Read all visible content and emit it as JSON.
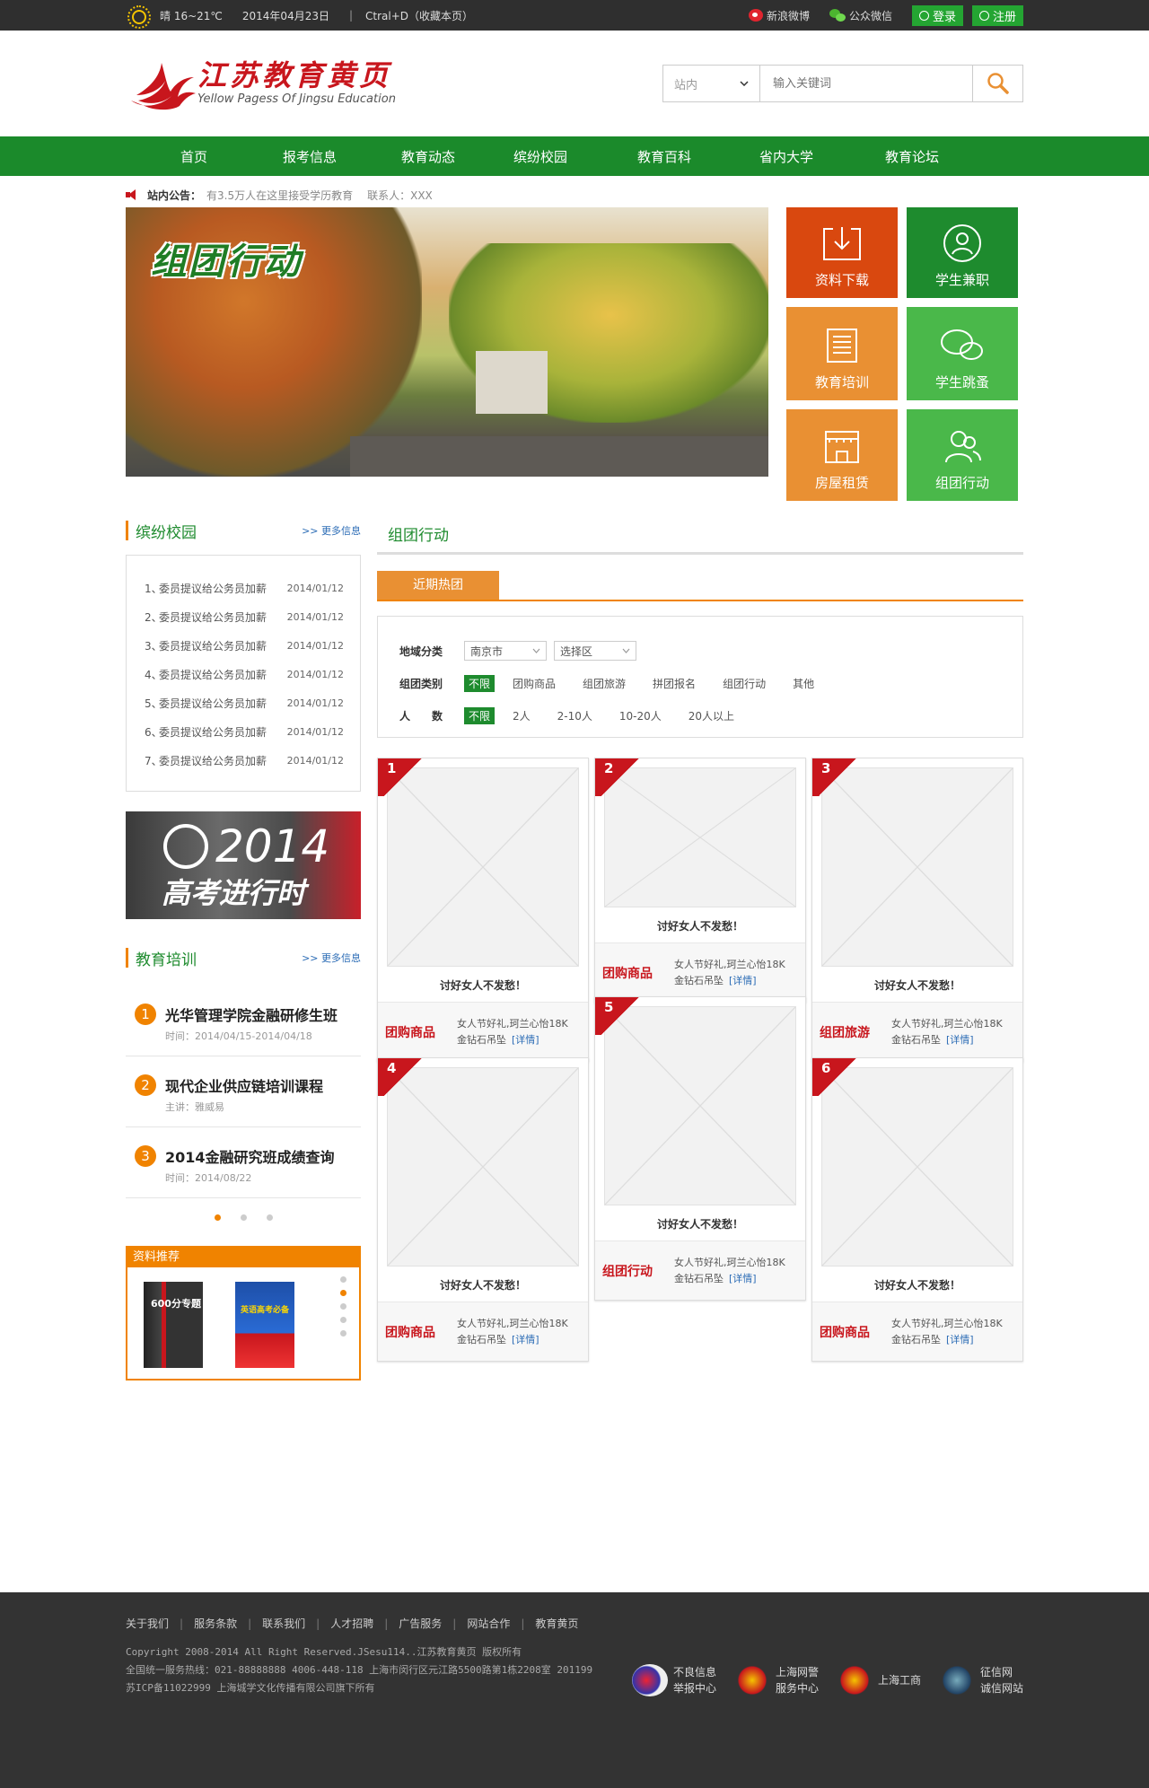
{
  "topbar": {
    "weather": "晴 16~21℃",
    "date": "2014年04月23日",
    "sep": "|",
    "bookmark": "Ctral+D（收藏本页）",
    "weibo": "新浪微博",
    "wechat": "公众微信",
    "login": "登录",
    "register": "注册"
  },
  "header": {
    "logo_title": "江苏教育黄页",
    "logo_sub": "Yellow Pagess Of Jingsu Education",
    "search_scope": "站内",
    "search_placeholder": "输入关键词"
  },
  "nav": [
    "首页",
    "报考信息",
    "教育动态",
    "缤纷校园",
    "教育百科",
    "省内大学",
    "教育论坛"
  ],
  "notice": {
    "label": "站内公告：",
    "text": "有3.5万人在这里接受学历教育",
    "contact": "联系人：XXX"
  },
  "banner": {
    "title": "组团行动"
  },
  "tiles": [
    {
      "label": "资料下载",
      "icon": "download-icon",
      "color": "#d9480f"
    },
    {
      "label": "学生兼职",
      "icon": "user-icon",
      "color": "#1e8b2e"
    },
    {
      "label": "教育培训",
      "icon": "document-icon",
      "color": "#e99033"
    },
    {
      "label": "学生跳蚤",
      "icon": "chat-icon",
      "color": "#4ab84a"
    },
    {
      "label": "房屋租赁",
      "icon": "house-icon",
      "color": "#e99033"
    },
    {
      "label": "组团行动",
      "icon": "group-icon",
      "color": "#4ab84a"
    }
  ],
  "campus": {
    "title": "缤纷校园",
    "more": "更多信息",
    "items": [
      {
        "n": "1、",
        "t": "委员提议给公务员加薪",
        "d": "2014/01/12"
      },
      {
        "n": "2、",
        "t": "委员提议给公务员加薪",
        "d": "2014/01/12"
      },
      {
        "n": "3、",
        "t": "委员提议给公务员加薪",
        "d": "2014/01/12"
      },
      {
        "n": "4、",
        "t": "委员提议给公务员加薪",
        "d": "2014/01/12"
      },
      {
        "n": "5、",
        "t": "委员提议给公务员加薪",
        "d": "2014/01/12"
      },
      {
        "n": "6、",
        "t": "委员提议给公务员加薪",
        "d": "2014/01/12"
      },
      {
        "n": "7、",
        "t": "委员提议给公务员加薪",
        "d": "2014/01/12"
      }
    ]
  },
  "gaokao": {
    "year": "2014",
    "slogan": "高考进行时"
  },
  "training": {
    "title": "教育培训",
    "more": "更多信息",
    "items": [
      {
        "n": "1",
        "t": "光华管理学院金融研修生班",
        "s": "时间：2014/04/15-2014/04/18"
      },
      {
        "n": "2",
        "t": "现代企业供应链培训课程",
        "s": "主讲：雅威易"
      },
      {
        "n": "3",
        "t": "2014金融研究班成绩查询",
        "s": "时间：2014/08/22"
      }
    ]
  },
  "materials": {
    "title": "资料推荐",
    "book1": "600分专题",
    "book2": "英语高考必备"
  },
  "group": {
    "title": "组团行动",
    "tab": "近期热团",
    "filters": {
      "region_label": "地域分类",
      "city": "南京市",
      "district": "选择区",
      "type_label": "组团类别",
      "types": [
        "不限",
        "团购商品",
        "组团旅游",
        "拼团报名",
        "组团行动",
        "其他"
      ],
      "people_label": "人　　数",
      "people": [
        "不限",
        "2人",
        "2-10人",
        "10-20人",
        "20人以上"
      ]
    },
    "cards": [
      {
        "n": "1",
        "cap": "讨好女人不发愁！",
        "cat": "团购商品",
        "d1": "女人节好礼,珂兰心怡18K",
        "d2": "金钻石吊坠",
        "link": "[详情]"
      },
      {
        "n": "2",
        "cap": "讨好女人不发愁！",
        "cat": "团购商品",
        "d1": "女人节好礼,珂兰心怡18K",
        "d2": "金钻石吊坠",
        "link": "[详情]"
      },
      {
        "n": "3",
        "cap": "讨好女人不发愁！",
        "cat": "组团旅游",
        "d1": "女人节好礼,珂兰心怡18K",
        "d2": "金钻石吊坠",
        "link": "[详情]"
      },
      {
        "n": "4",
        "cap": "讨好女人不发愁！",
        "cat": "团购商品",
        "d1": "女人节好礼,珂兰心怡18K",
        "d2": "金钻石吊坠",
        "link": "[详情]"
      },
      {
        "n": "5",
        "cap": "讨好女人不发愁！",
        "cat": "组团行动",
        "d1": "女人节好礼,珂兰心怡18K",
        "d2": "金钻石吊坠",
        "link": "[详情]"
      },
      {
        "n": "6",
        "cap": "讨好女人不发愁！",
        "cat": "团购商品",
        "d1": "女人节好礼,珂兰心怡18K",
        "d2": "金钻石吊坠",
        "link": "[详情]"
      }
    ]
  },
  "footer": {
    "links": [
      "关于我们",
      "服务条款",
      "联系我们",
      "人才招聘",
      "广告服务",
      "网站合作",
      "教育黄页"
    ],
    "copyright": "Copyright 2008-2014 All Right Reserved.JSesu114..江苏教育黄页 版权所有",
    "hotline": "全国统一服务热线：021-88888888 4006-448-118  上海市闵行区元江路5500路第1栋2208室 201199",
    "icp": "苏ICP备11022999  上海城学文化传播有限公司旗下所有",
    "badges": [
      {
        "l1": "不良信息",
        "l2": "举报中心"
      },
      {
        "l1": "上海网警",
        "l2": "服务中心"
      },
      {
        "l1": "上海工商",
        "l2": ""
      },
      {
        "l1": "征信网",
        "l2": "诚信网站"
      }
    ]
  }
}
